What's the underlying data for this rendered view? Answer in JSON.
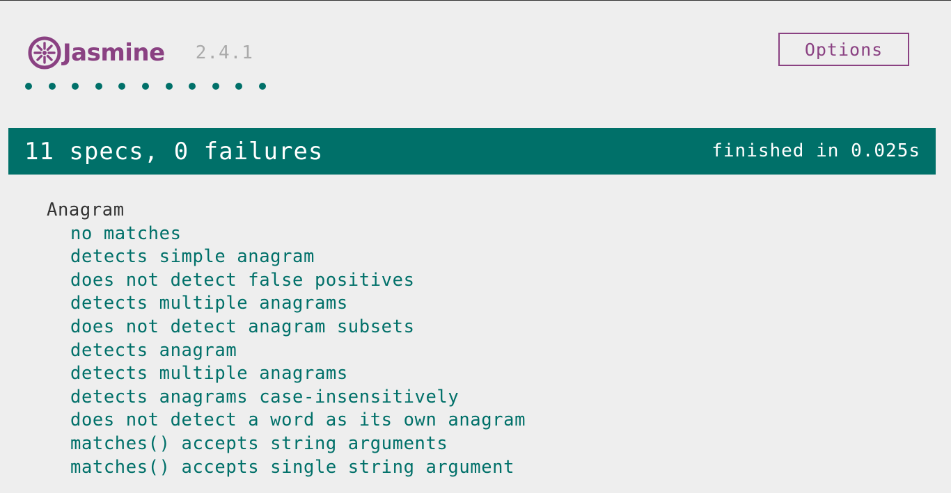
{
  "banner": {
    "logo_text": "Jasmine",
    "version": "2.4.1",
    "options_label": "Options"
  },
  "dots": {
    "count": 11,
    "color": "#007069"
  },
  "summary": {
    "text": "11 specs, 0 failures",
    "duration": "finished in 0.025s",
    "color": "#007069"
  },
  "suite": {
    "title": "Anagram",
    "specs": [
      "no matches",
      "detects simple anagram",
      "does not detect false positives",
      "detects multiple anagrams",
      "does not detect anagram subsets",
      "detects anagram",
      "detects multiple anagrams",
      "detects anagrams case-insensitively",
      "does not detect a word as its own anagram",
      "matches() accepts string arguments",
      "matches() accepts single string argument"
    ]
  },
  "colors": {
    "brand": "#8a4182",
    "pass": "#007069",
    "background": "#eeeeee",
    "version": "#aaaaaa"
  },
  "icons": {
    "logo": "jasmine-flower-icon",
    "spec_status": "passed-dot-icon"
  }
}
